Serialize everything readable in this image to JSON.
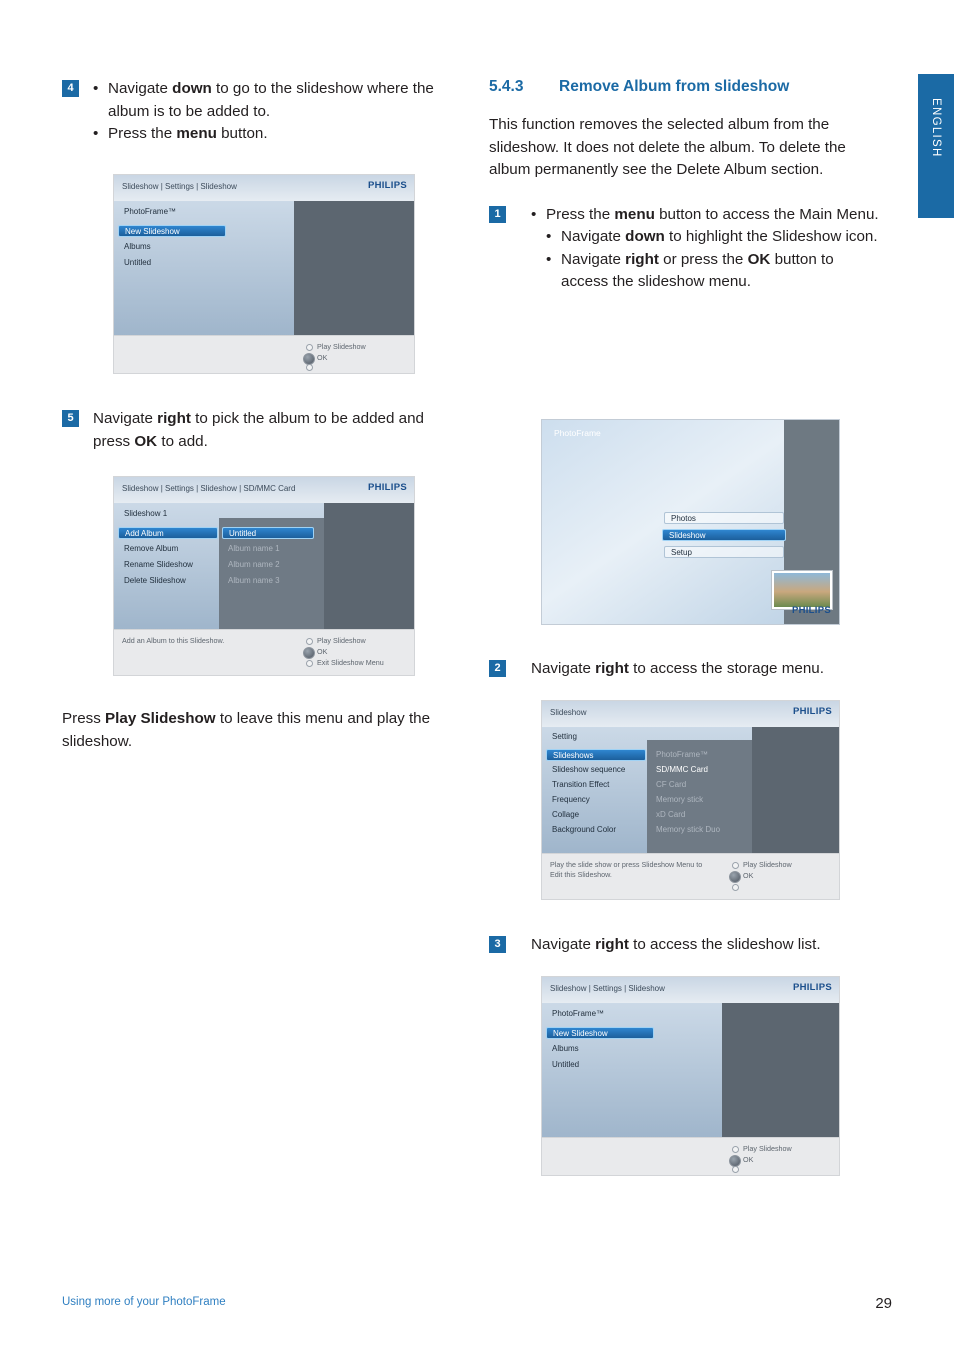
{
  "side_tab": {
    "label": "ENGLISH"
  },
  "left_column": {
    "step4": {
      "number": "4",
      "bullets": [
        "Navigate down to go to the slideshow where the album is to be added to.",
        "Press the menu button."
      ]
    },
    "screen_new_slideshow": {
      "title": "Slideshow | Settings | Slideshow",
      "logo": "PHILIPS",
      "header_item": "PhotoFrame™",
      "menu": [
        "New Slideshow",
        "Albums",
        "Untitled"
      ],
      "selected": "New Slideshow",
      "footer_buttons": [
        "Play Slideshow",
        "OK"
      ]
    },
    "step5": {
      "number": "5",
      "text": "Navigate right to pick the album to be added and press OK to add."
    },
    "screen_add_album": {
      "title": "Slideshow | Settings | Slideshow | SD/MMC Card",
      "logo": "PHILIPS",
      "header_item": "Slideshow 1",
      "menu": [
        "Add Album",
        "Remove Album",
        "Rename Slideshow",
        "Delete Slideshow"
      ],
      "selected": "Add Album",
      "submenu": [
        "Untitled",
        "Album name 1",
        "Album name 2",
        "Album name 3"
      ],
      "submenu_selected": "Untitled",
      "footer_hint": "Add an Album to this Slideshow.",
      "footer_buttons": [
        "Play Slideshow",
        "OK",
        "Exit Slideshow Menu"
      ]
    },
    "closing_paragraph": "Press Play Slideshow to leave this menu and play the slideshow."
  },
  "right_column": {
    "section": {
      "number": "5.4.3",
      "title": "Remove Album from slideshow"
    },
    "intro": "This function removes the selected album from the slideshow. It does not delete the album. To delete the album permanently see the Delete Album section.",
    "step1": {
      "number": "1",
      "bullets": [
        "Press the menu button to access the Main Menu.",
        "Navigate down to highlight the Slideshow icon.",
        "Navigate right or press the OK button to access the slideshow menu."
      ]
    },
    "screen_main_menu": {
      "title": "PhotoFrame",
      "logo": "PHILIPS",
      "menu": [
        "Photos",
        "Slideshow",
        "Setup"
      ],
      "selected": "Slideshow"
    },
    "step2": {
      "number": "2",
      "text": "Navigate right to access the storage menu."
    },
    "screen_storage": {
      "title": "Slideshow",
      "logo": "PHILIPS",
      "header_item": "Setting",
      "menu": [
        "Slideshows",
        "Slideshow sequence",
        "Transition Effect",
        "Frequency",
        "Collage",
        "Background Color"
      ],
      "selected": "Slideshows",
      "submenu": [
        "PhotoFrame™",
        "SD/MMC  Card",
        "CF Card",
        "Memory stick",
        "xD Card",
        "Memory stick Duo"
      ],
      "submenu_selected": "SD/MMC  Card",
      "footer_hint": "Play the slide show or press Slideshow Menu to Edit this Slideshow.",
      "footer_buttons": [
        "Play Slideshow",
        "OK"
      ]
    },
    "step3": {
      "number": "3",
      "text": "Navigate right to access the slideshow list."
    },
    "screen_slideshow_list": {
      "title": "Slideshow | Settings | Slideshow",
      "logo": "PHILIPS",
      "header_item": "PhotoFrame™",
      "menu": [
        "New Slideshow",
        "Albums",
        "Untitled"
      ],
      "selected": "New Slideshow",
      "footer_buttons": [
        "Play Slideshow",
        "OK"
      ]
    }
  },
  "footer": {
    "left": "Using more of your PhotoFrame",
    "page": "29"
  }
}
